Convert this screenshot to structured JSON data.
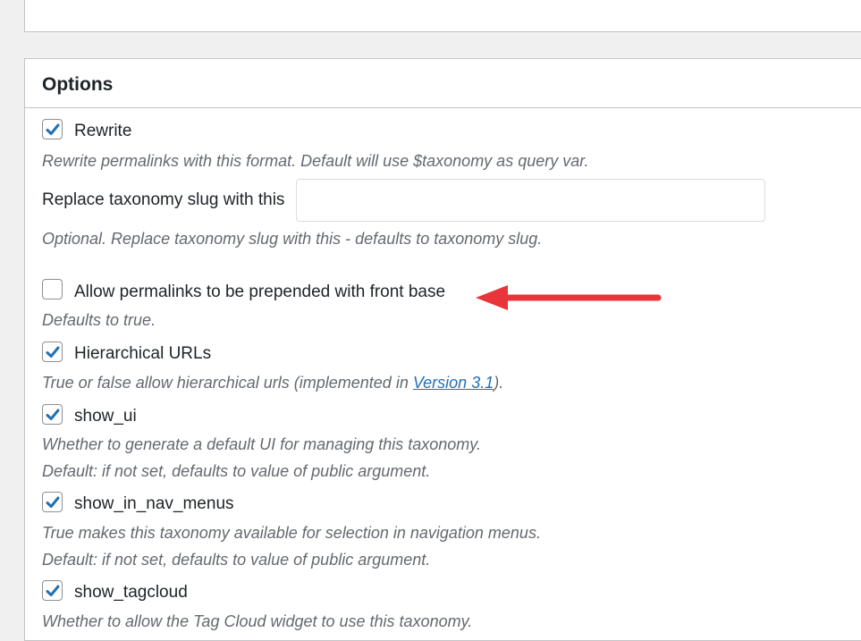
{
  "section": {
    "title": "Options"
  },
  "options": {
    "rewrite": {
      "label": "Rewrite",
      "checked": true,
      "description": "Rewrite permalinks with this format. Default will use $taxonomy as query var."
    },
    "slug": {
      "label": "Replace taxonomy slug with this",
      "value": "",
      "description": "Optional. Replace taxonomy slug with this - defaults to taxonomy slug."
    },
    "front_base": {
      "label": "Allow permalinks to be prepended with front base",
      "checked": false,
      "description": "Defaults to true."
    },
    "hierarchical": {
      "label": "Hierarchical URLs",
      "checked": true,
      "description_before": "True or false allow hierarchical urls (implemented in ",
      "link": "Version 3.1",
      "description_after": ")."
    },
    "show_ui": {
      "label": "show_ui",
      "checked": true,
      "description_1": "Whether to generate a default UI for managing this taxonomy.",
      "description_2": "Default: if not set, defaults to value of public argument."
    },
    "show_in_nav_menus": {
      "label": "show_in_nav_menus",
      "checked": true,
      "description_1": "True makes this taxonomy available for selection in navigation menus.",
      "description_2": "Default: if not set, defaults to value of public argument."
    },
    "show_tagcloud": {
      "label": "show_tagcloud",
      "checked": true,
      "description_1": "Whether to allow the Tag Cloud widget to use this taxonomy."
    }
  },
  "colors": {
    "accent": "#2271b1",
    "annotation_arrow": "#e8343a",
    "description": "#646970"
  },
  "icons": {
    "check": "checkmark-icon",
    "annotation": "red-arrow-icon"
  }
}
